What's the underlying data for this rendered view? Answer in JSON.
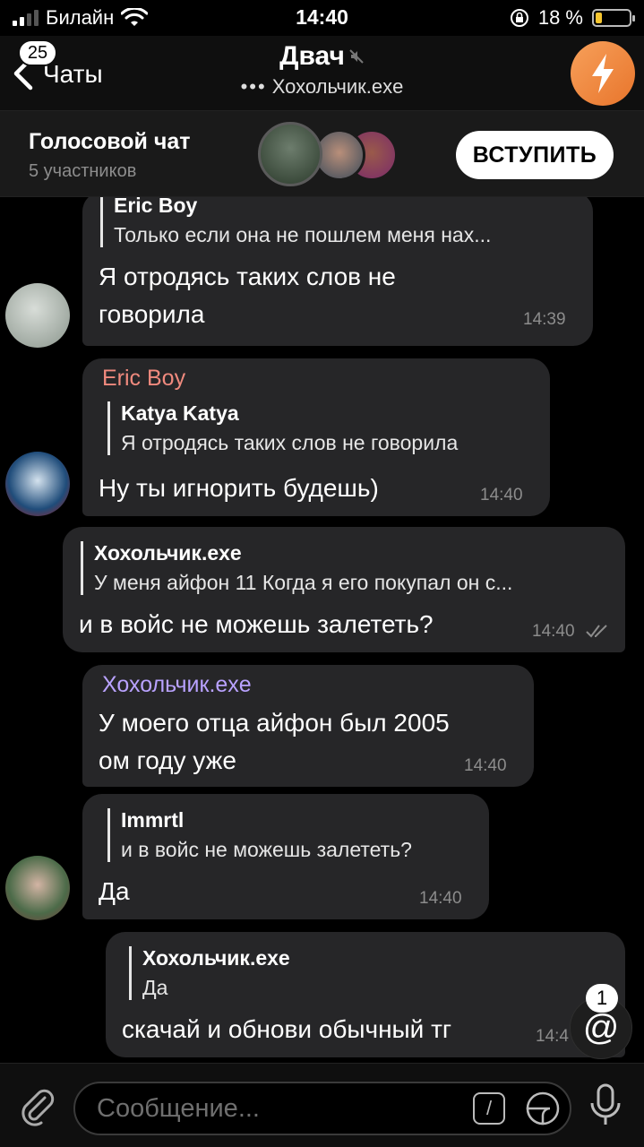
{
  "status_bar": {
    "carrier": "Билайн",
    "time": "14:40",
    "battery": "18 %"
  },
  "nav": {
    "back_label": "Чаты",
    "unread_badge": "25",
    "title": "Двач",
    "subtitle_dots": "•••",
    "subtitle": "Хохольчик.exe"
  },
  "voice_chat": {
    "title": "Голосовой чат",
    "participants": "5 участников",
    "join_label": "ВСТУПИТЬ"
  },
  "messages": [
    {
      "reply_name": "Eric Boy",
      "reply_text": "Только если она не пошлем меня нах...",
      "text_line1": "Я отродясь таких слов не",
      "text_line2": "говорила",
      "time": "14:39"
    },
    {
      "sender": "Eric Boy",
      "sender_color": "#f08a7e",
      "reply_name": "Katya Katya",
      "reply_text": "Я отродясь таких слов не говорила",
      "text": "Ну ты игнорить будешь)",
      "time": "14:40"
    },
    {
      "reply_name": "Хохольчик.exe",
      "reply_text": "У меня айфон 11  Когда я его покупал он с...",
      "text": "и в войс не можешь залететь?",
      "time": "14:40"
    },
    {
      "sender": "Хохольчик.exe",
      "sender_color": "#b9a2ff",
      "text_line1": "У моего отца айфон был 2005",
      "text_line2": "ом году уже",
      "time": "14:40"
    },
    {
      "reply_name": "Immrtl",
      "reply_text": "и в войс не можешь залететь?",
      "text": "Да",
      "time": "14:40"
    },
    {
      "reply_name": "Хохольчик.exe",
      "reply_text": "Да",
      "text": "скачай и обнови обычный тг",
      "time": "14:4"
    }
  ],
  "mention_badge": {
    "count": "1",
    "symbol": "@"
  },
  "input": {
    "placeholder": "Сообщение...",
    "command_symbol": "/"
  },
  "icons": [
    "signal-icon",
    "wifi-icon",
    "lock-rotation-icon",
    "battery-icon",
    "back-chevron-icon",
    "mute-icon",
    "bolt-icon",
    "attach-icon",
    "command-icon",
    "sticker-icon",
    "mic-icon",
    "double-check-icon"
  ]
}
